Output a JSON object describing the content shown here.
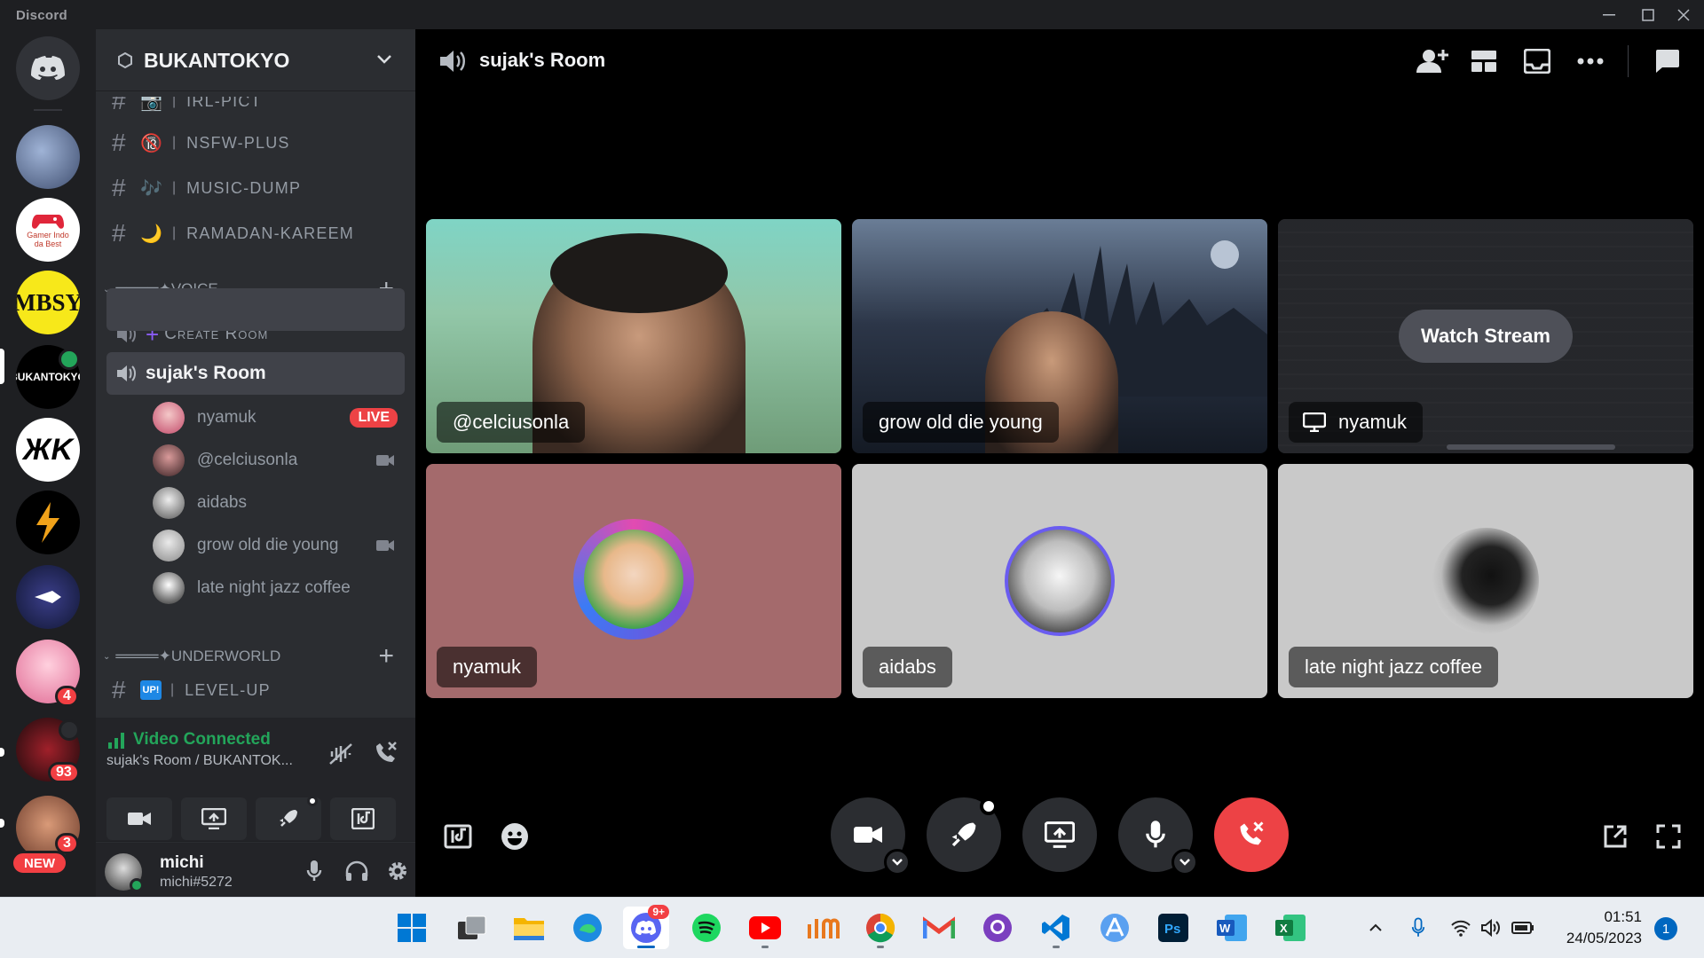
{
  "app": {
    "title": "Discord"
  },
  "rail": {
    "badges": {
      "s8": "4",
      "s9": "93",
      "s10": "3"
    },
    "new_label": "NEW",
    "mbsy": "MBSY",
    "gamer": "Gamer Indo da Best",
    "bukan": "BUKANTOKYO"
  },
  "server": {
    "name": "BUKANTOKYO"
  },
  "channels": [
    {
      "emoji": "📷",
      "name": "irl-pict"
    },
    {
      "emoji": "🔞",
      "name": "nsfw-plus"
    },
    {
      "emoji": "🎶",
      "name": "music-dump"
    },
    {
      "emoji": "🌙",
      "name": "ramadan-kareem"
    }
  ],
  "voice_category": "════✦VOICE",
  "create_room": "Create Room",
  "active_voice": "sujak's Room",
  "voice_users": [
    {
      "name": "nyamuk",
      "live": "LIVE"
    },
    {
      "name": "@celciusonla"
    },
    {
      "name": "aidabs"
    },
    {
      "name": "grow old die young"
    },
    {
      "name": "late night jazz coffee"
    }
  ],
  "underworld_category": "════✦UNDERWORLD",
  "level_up": {
    "emoji": "UP!",
    "name": "level-up"
  },
  "voice_panel": {
    "status": "Video Connected",
    "sub": "sujak's Room / BUKANTOK..."
  },
  "user": {
    "name": "michi",
    "tag": "michi#5272"
  },
  "main": {
    "title": "sujak's Room",
    "watch_stream": "Watch Stream",
    "tiles": [
      {
        "name": "@celciusonla"
      },
      {
        "name": "grow old die young"
      },
      {
        "name": "nyamuk"
      },
      {
        "name": "nyamuk"
      },
      {
        "name": "aidabs"
      },
      {
        "name": "late night jazz coffee"
      }
    ]
  },
  "taskbar": {
    "discord_badge": "9+",
    "time": "01:51",
    "date": "24/05/2023",
    "notif": "1"
  },
  "colors": {
    "accent": "#5865f2",
    "green": "#23a55a",
    "red": "#ed4245",
    "nyamuk_bg": "#a46a6c",
    "light_bg": "#c9c9c9"
  }
}
